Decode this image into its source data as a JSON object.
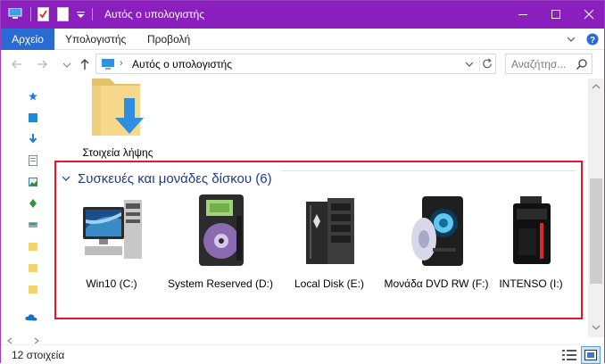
{
  "window": {
    "title": "Αυτός ο υπολογιστής"
  },
  "ribbon": {
    "tabs": [
      {
        "label": "Αρχείο",
        "active": true
      },
      {
        "label": "Υπολογιστής",
        "active": false
      },
      {
        "label": "Προβολή",
        "active": false
      }
    ]
  },
  "address": {
    "path": "Αυτός ο υπολογιστής",
    "search_placeholder": "Αναζήτησ..."
  },
  "folders": [
    {
      "label": "Στοιχεία λήψης"
    }
  ],
  "devices": {
    "header": "Συσκευές και μονάδες δίσκου (6)",
    "items": [
      {
        "label": "Win10 (C:)",
        "icon": "pc-tower-icon"
      },
      {
        "label": "System Reserved (D:)",
        "icon": "reserved-disk-icon"
      },
      {
        "label": "Local Disk (E:)",
        "icon": "server-disk-icon"
      },
      {
        "label": "Μονάδα DVD RW (F:)",
        "icon": "dvd-drive-icon"
      },
      {
        "label": "INTENSO (I:)",
        "icon": "usb-drive-icon"
      }
    ]
  },
  "status": {
    "items_count": "12 στοιχεία"
  },
  "colors": {
    "titlebar": "#8a1fbe",
    "file_tab": "#2b6bd1",
    "highlight_border": "#e8142b",
    "group_title": "#1e3a8a"
  }
}
